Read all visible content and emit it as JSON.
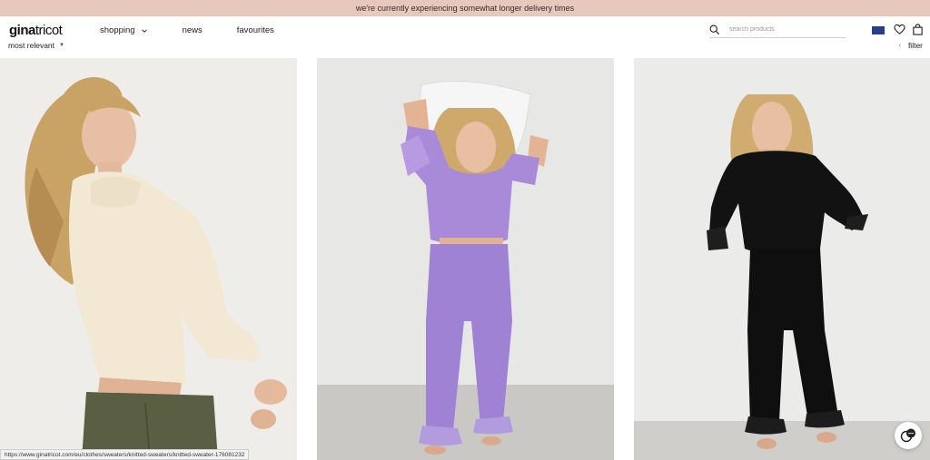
{
  "banner": {
    "text": "we're currently experiencing somewhat longer delivery times"
  },
  "header": {
    "logo": {
      "bold": "gina",
      "regular": "tricot"
    },
    "nav": [
      {
        "label": "shopping",
        "has_dropdown": true
      },
      {
        "label": "news",
        "has_dropdown": false
      },
      {
        "label": "favourites",
        "has_dropdown": false
      }
    ],
    "search": {
      "placeholder": "search products",
      "value": "",
      "icon": "search-icon"
    },
    "flag": {
      "icon": "eu-flag-icon",
      "color": "#2b3d8f"
    },
    "icons": [
      "heart-icon",
      "shopping-bag-icon"
    ]
  },
  "toolbar": {
    "sort_label": "most relevant",
    "filter_label": "filter"
  },
  "products": [
    {
      "image": "model-cream-knitted-sweater"
    },
    {
      "image": "model-lilac-satin-pyjamas"
    },
    {
      "image": "model-black-satin-pyjamas"
    }
  ],
  "status_bar": {
    "url": "https://www.ginatricot.com/eu/clothes/sweaters/knitted-sweaters/knitted-sweater-176081232"
  },
  "colors": {
    "banner_bg": "#e8c8bd",
    "status_bar_accent": "#e07b2f"
  }
}
